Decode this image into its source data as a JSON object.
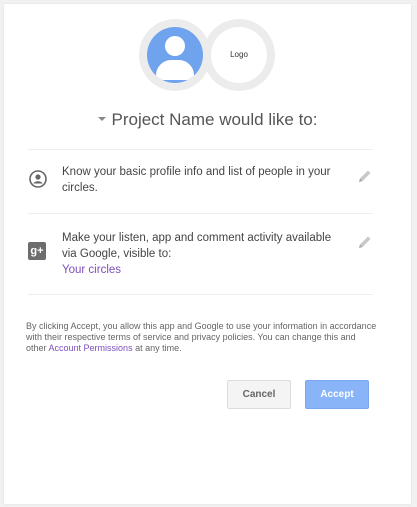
{
  "header": {
    "logo_label": "Logo",
    "title": "Project Name would like to:"
  },
  "permissions": [
    {
      "icon": "profile-icon",
      "text": "Know your basic profile info and list of people in your circles."
    },
    {
      "icon": "google-plus-icon",
      "text": "Make your listen, app and comment activity available via Google, visible to:",
      "link": "Your circles"
    }
  ],
  "disclaimer": {
    "before": "By clicking Accept, you allow this app and Google to use your information in accordance with their respective terms of service and privacy policies. You can change this and other ",
    "link": "Account Permissions",
    "after": " at any time."
  },
  "buttons": {
    "cancel": "Cancel",
    "accept": "Accept"
  },
  "colors": {
    "accent": "#8ab4f8",
    "link": "#7d4fbe",
    "avatar": "#6fa3ed"
  }
}
